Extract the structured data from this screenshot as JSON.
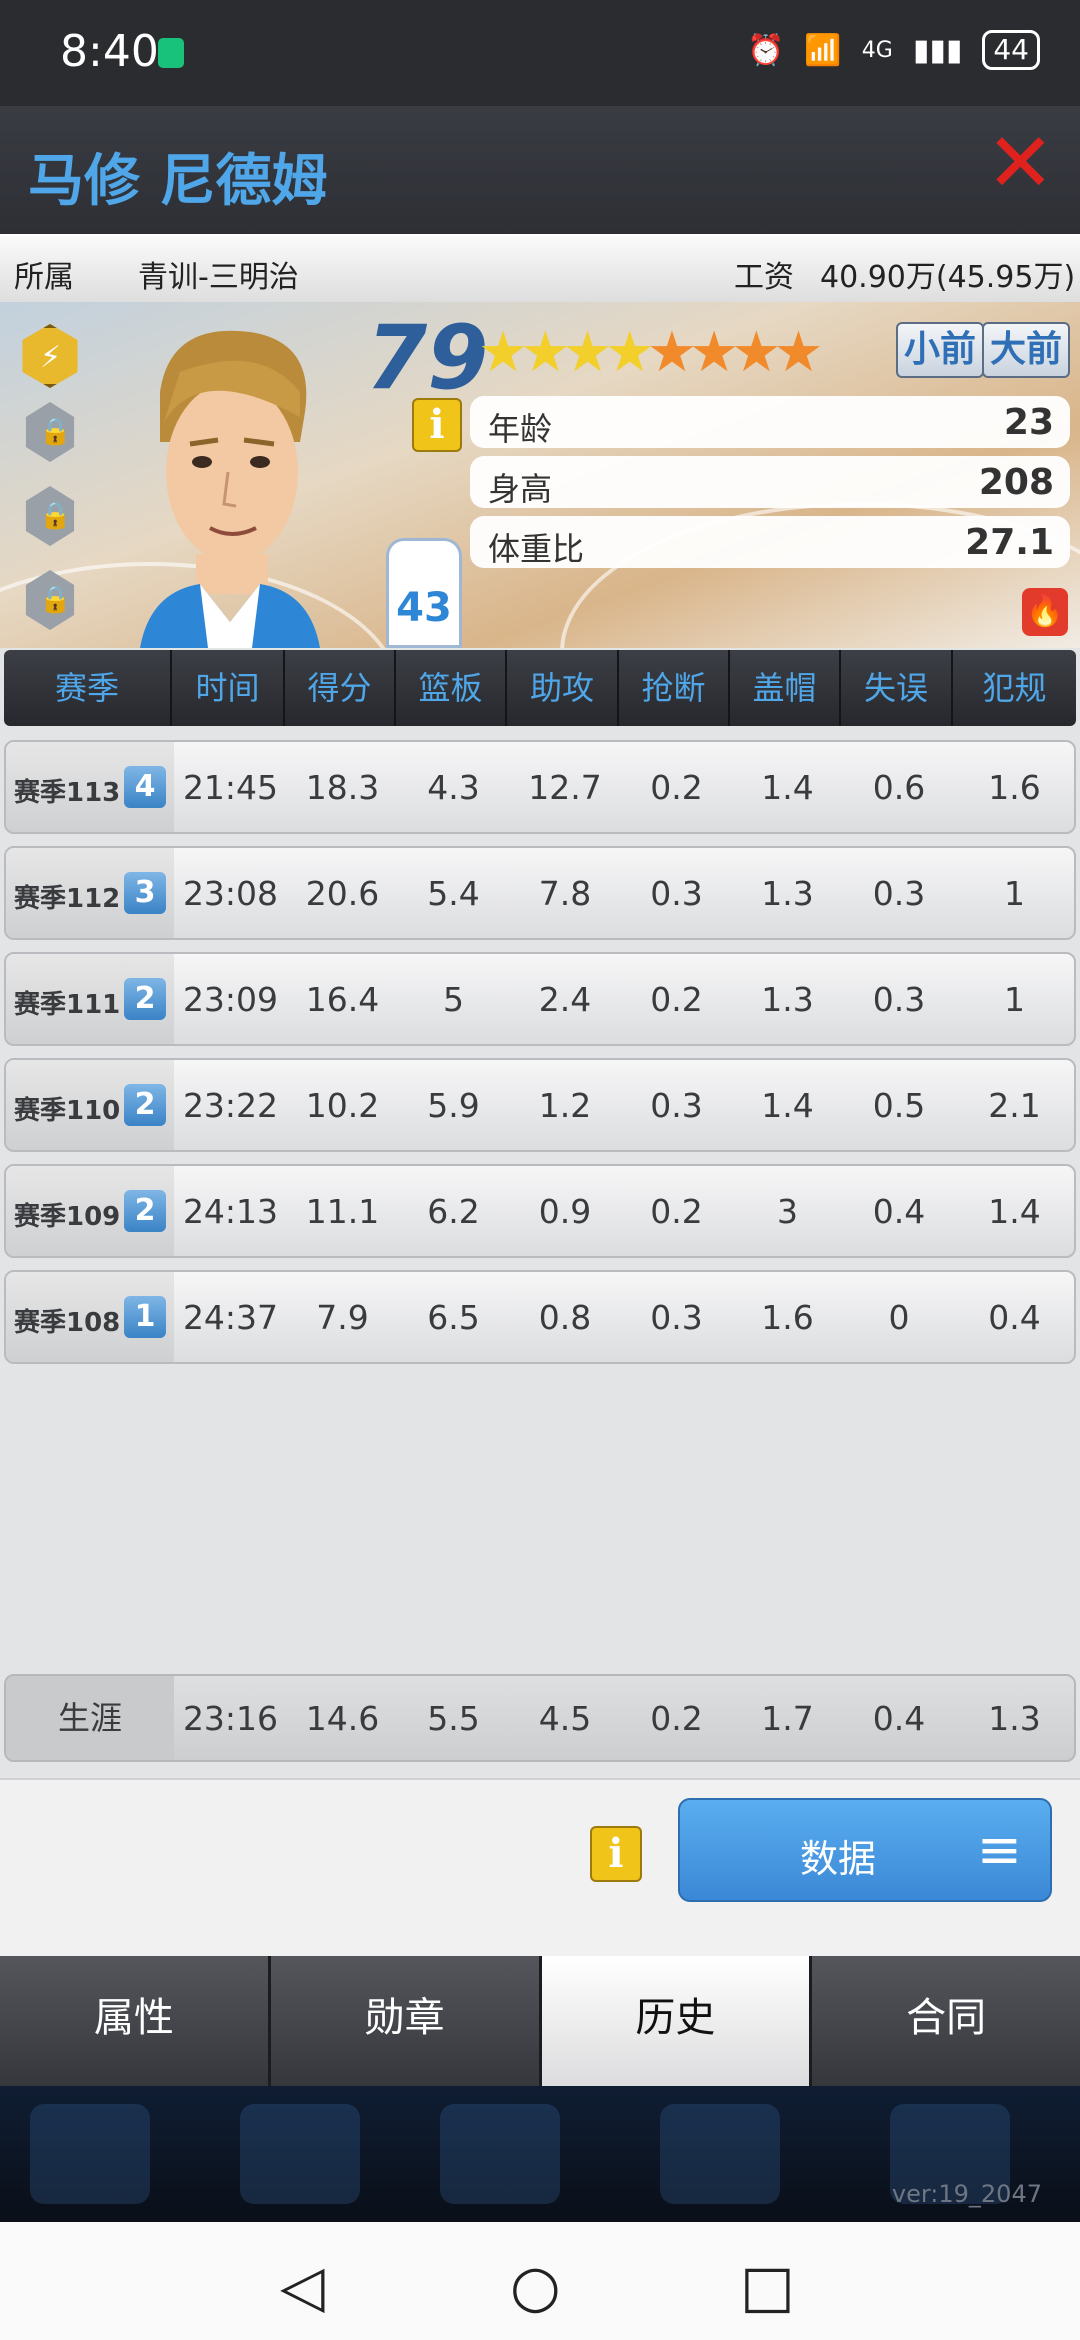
{
  "status": {
    "time": "8:40",
    "network": "4G",
    "battery": "44"
  },
  "header": {
    "player_name": "马修 尼德姆"
  },
  "info": {
    "team_label": "所属",
    "team": "青训-三明治",
    "salary_label": "工资",
    "salary": "40.90万(45.95万)"
  },
  "card": {
    "rating": "79",
    "stars": {
      "yellow": 4,
      "orange": 4
    },
    "positions": [
      "小前",
      "大前"
    ],
    "attributes": [
      {
        "label": "年龄",
        "value": "23"
      },
      {
        "label": "身高",
        "value": "208"
      },
      {
        "label": "体重比",
        "value": "27.1"
      }
    ],
    "jersey_number": "43"
  },
  "table": {
    "headers": [
      "赛季",
      "时间",
      "得分",
      "篮板",
      "助攻",
      "抢断",
      "盖帽",
      "失误",
      "犯规"
    ],
    "rows": [
      {
        "season": "赛季113",
        "level": "4",
        "cells": [
          "21:45",
          "18.3",
          "4.3",
          "12.7",
          "0.2",
          "1.4",
          "0.6",
          "1.6"
        ]
      },
      {
        "season": "赛季112",
        "level": "3",
        "cells": [
          "23:08",
          "20.6",
          "5.4",
          "7.8",
          "0.3",
          "1.3",
          "0.3",
          "1"
        ]
      },
      {
        "season": "赛季111",
        "level": "2",
        "cells": [
          "23:09",
          "16.4",
          "5",
          "2.4",
          "0.2",
          "1.3",
          "0.3",
          "1"
        ]
      },
      {
        "season": "赛季110",
        "level": "2",
        "cells": [
          "23:22",
          "10.2",
          "5.9",
          "1.2",
          "0.3",
          "1.4",
          "0.5",
          "2.1"
        ]
      },
      {
        "season": "赛季109",
        "level": "2",
        "cells": [
          "24:13",
          "11.1",
          "6.2",
          "0.9",
          "0.2",
          "3",
          "0.4",
          "1.4"
        ]
      },
      {
        "season": "赛季108",
        "level": "1",
        "cells": [
          "24:37",
          "7.9",
          "6.5",
          "0.8",
          "0.3",
          "1.6",
          "0",
          "0.4"
        ]
      }
    ],
    "career": {
      "label": "生涯",
      "cells": [
        "23:16",
        "14.6",
        "5.5",
        "4.5",
        "0.2",
        "1.7",
        "0.4",
        "1.3"
      ]
    }
  },
  "actions": {
    "data_button": "数据"
  },
  "tabs": [
    {
      "label": "属性",
      "active": false
    },
    {
      "label": "勋章",
      "active": false
    },
    {
      "label": "历史",
      "active": true
    },
    {
      "label": "合同",
      "active": false
    }
  ],
  "footer": {
    "version": "ver:19_2047"
  },
  "icons": {
    "close": "close-icon",
    "info": "info-icon",
    "menu": "menu-icon",
    "fire": "fire-icon",
    "lock": "lock-icon"
  }
}
